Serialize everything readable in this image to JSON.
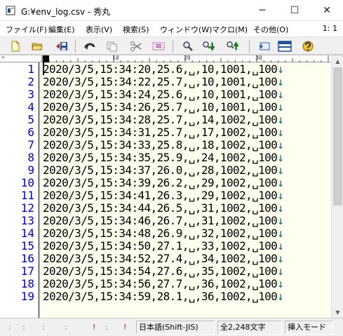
{
  "window": {
    "title": "G:¥env_log.csv - 秀丸",
    "minimize_glyph": "─",
    "maximize_glyph": "☐",
    "close_glyph": "✕"
  },
  "menu": {
    "items": [
      "ファイル(F)",
      "編集(E)",
      "表示(V)",
      "検索(S)",
      "ウィンドウ(W)",
      "マクロ(M)",
      "その他(O)"
    ],
    "position": "1: 1"
  },
  "toolbar": {
    "buttons": [
      "new-file-icon",
      "open-folder-icon",
      "save-icon",
      "undo-icon",
      "copy-icon",
      "cut-icon",
      "paste-icon",
      "search-icon",
      "search-down-icon",
      "search-up-icon",
      "tag-jump-icon",
      "split-window-icon",
      "help-icon"
    ]
  },
  "ruler": {
    "corner": "»",
    "marks": [
      "10",
      "20",
      "30"
    ]
  },
  "editor": {
    "eol_mark": "↓",
    "line_numbers": [
      "1",
      "2",
      "3",
      "4",
      "5",
      "6",
      "7",
      "8",
      "9",
      "10",
      "11",
      "12",
      "13",
      "14",
      "15",
      "16",
      "17",
      "18",
      "19"
    ],
    "lines": [
      "2020/3/5,15:34:20,25.6,␣,10,1001,␣100",
      "2020/3/5,15:34:22,25.7,␣,10,1001,␣100",
      "2020/3/5,15:34:24,25.6,␣,10,1001,␣100",
      "2020/3/5,15:34:26,25.7,␣,10,1001,␣100",
      "2020/3/5,15:34:28,25.7,␣,14,1002,␣100",
      "2020/3/5,15:34:31,25.7,␣,17,1002,␣100",
      "2020/3/5,15:34:33,25.8,␣,18,1002,␣100",
      "2020/3/5,15:34:35,25.9,␣,24,1002,␣100",
      "2020/3/5,15:34:37,26.0,␣,28,1002,␣100",
      "2020/3/5,15:34:39,26.2,␣,29,1002,␣100",
      "2020/3/5,15:34:41,26.3,␣,29,1002,␣100",
      "2020/3/5,15:34:44,26.5,␣,31,1002,␣100",
      "2020/3/5,15:34:46,26.7,␣,31,1002,␣100",
      "2020/3/5,15:34:48,26.9,␣,32,1002,␣100",
      "2020/3/5,15:34:50,27.1,␣,33,1002,␣100",
      "2020/3/5,15:34:52,27.4,␣,34,1002,␣100",
      "2020/3/5,15:34:54,27.6,␣,35,1002,␣100",
      "2020/3/5,15:34:56,27.7,␣,36,1002,␣100",
      "2020/3/5,15:34:59,28.1,␣,36,1002,␣100"
    ]
  },
  "statusbar": {
    "marks": [
      ":",
      ":",
      ":",
      ":",
      "!",
      ":",
      "!"
    ],
    "encoding": "日本語(Shift-JIS)",
    "char_count": "全2,248文字",
    "mode": "挿入モード"
  },
  "colors": {
    "line_number": "#0000cc",
    "eol": "#007070",
    "text_background": "#fffff0"
  }
}
